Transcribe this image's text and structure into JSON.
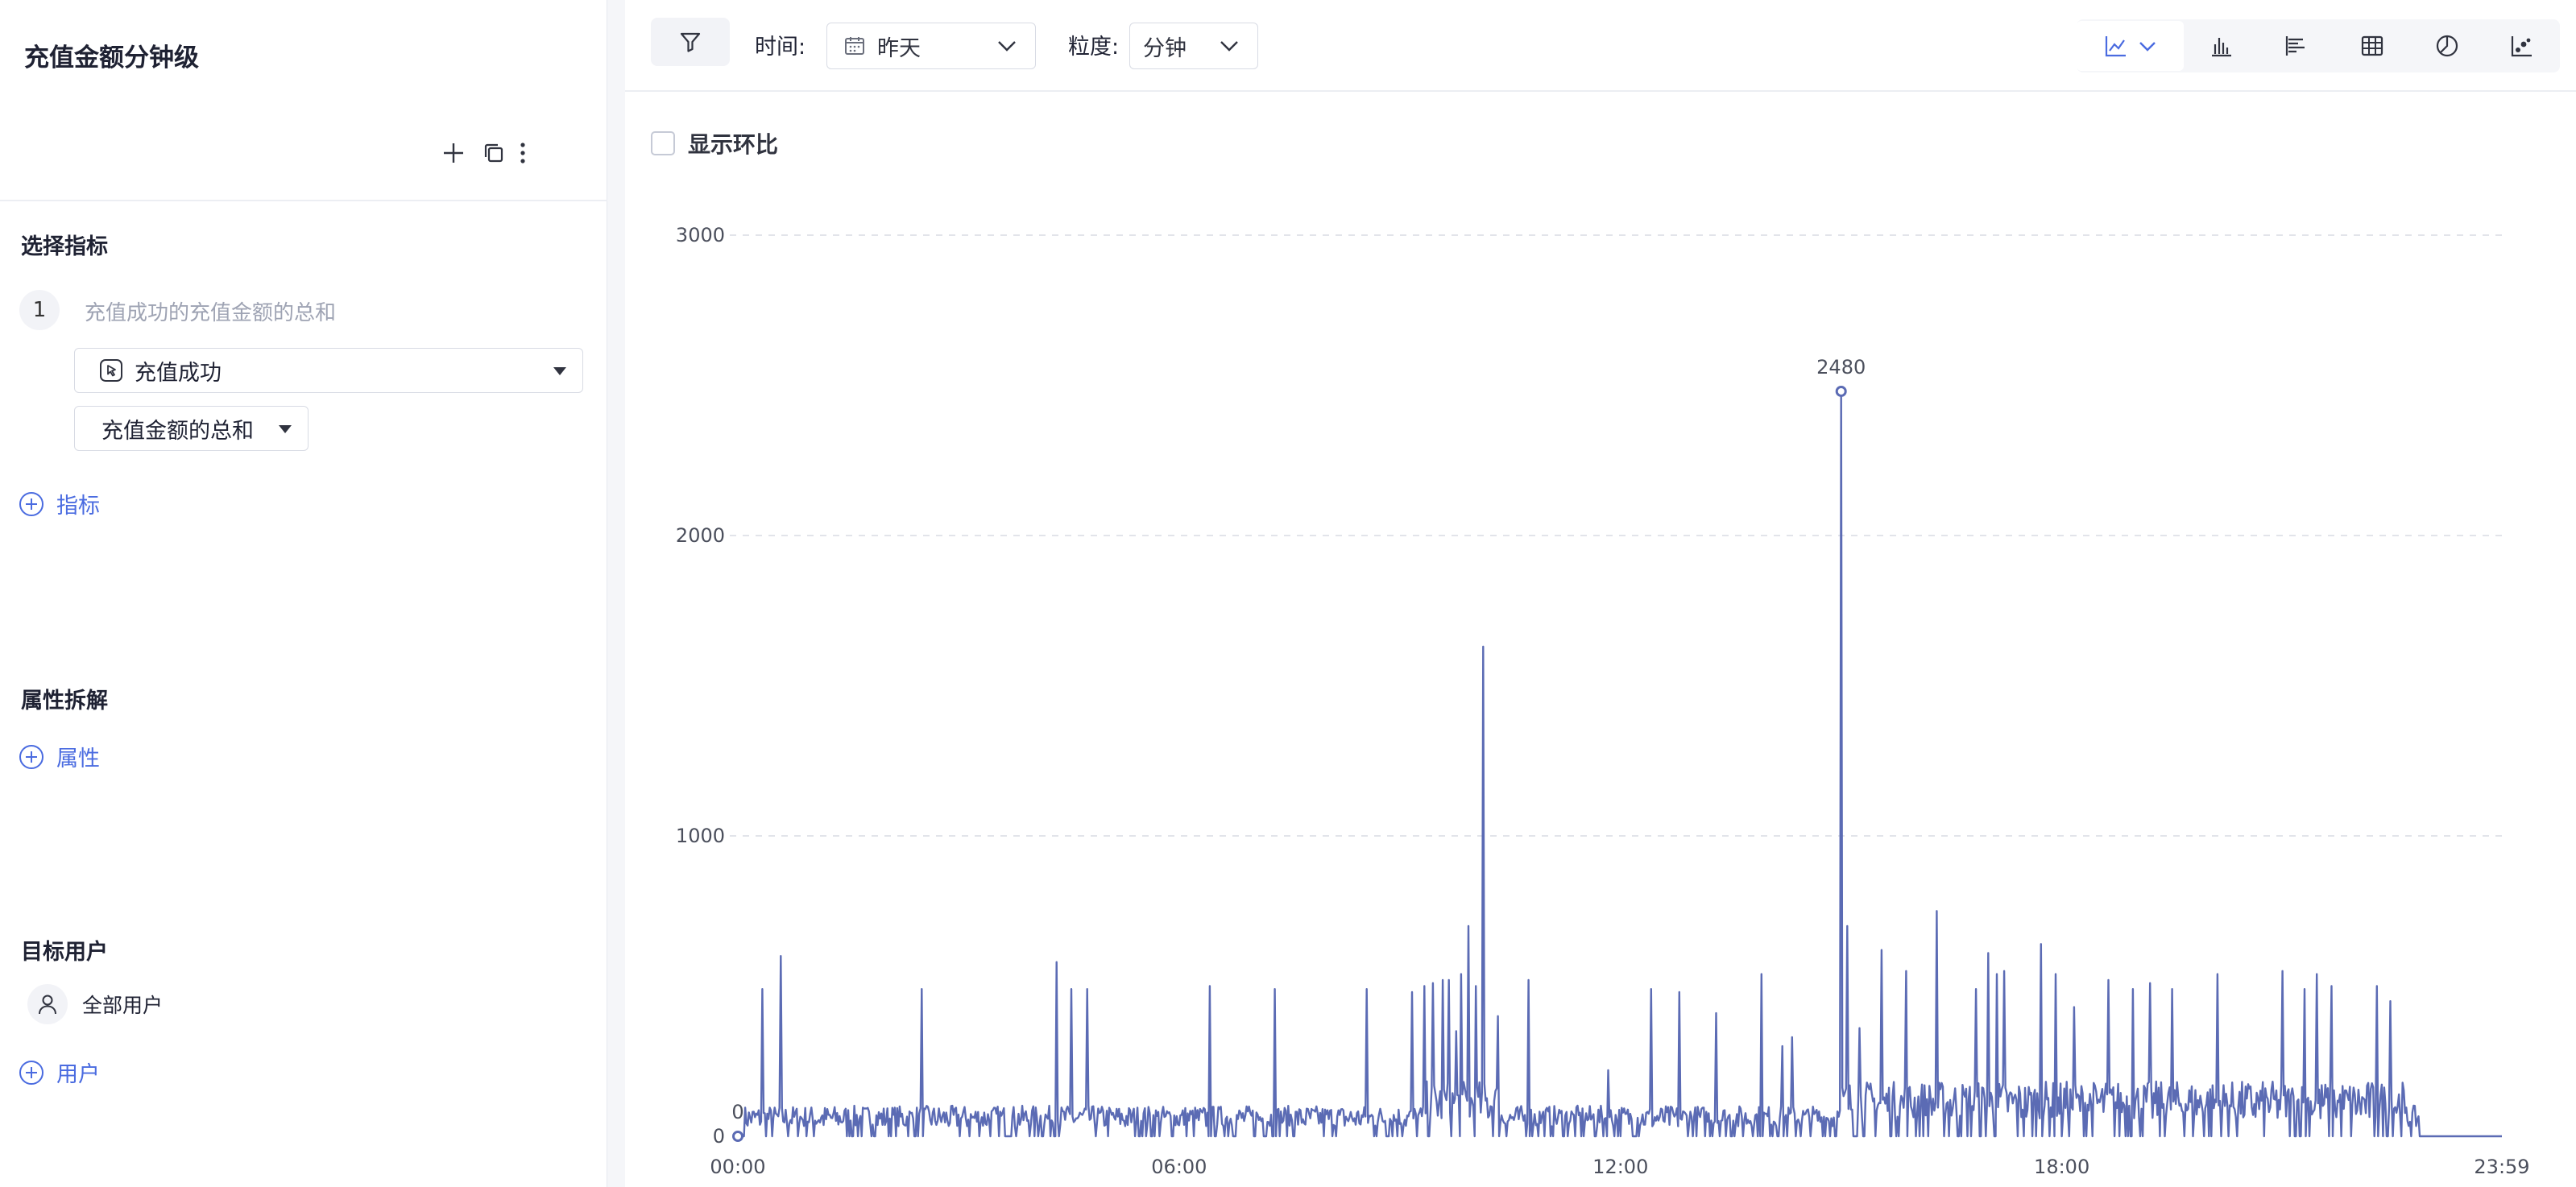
{
  "left": {
    "title": "充值金额分钟级",
    "sections": {
      "metrics": "选择指标",
      "breakdown": "属性拆解",
      "target_users": "目标用户"
    },
    "metric": {
      "index": "1",
      "name": "充值成功的充值金额的总和",
      "event": "充值成功",
      "aggregation": "充值金额的总和"
    },
    "add_metric": "指标",
    "add_property": "属性",
    "all_users": "全部用户",
    "add_user": "用户"
  },
  "toolbar": {
    "time_label": "时间:",
    "time_value": "昨天",
    "granularity_label": "粒度:",
    "granularity_value": "分钟",
    "viz_icons": [
      "line-chart-icon",
      "bar-chart-icon",
      "horizontal-bar-icon",
      "table-icon",
      "pie-chart-icon",
      "scatter-icon"
    ]
  },
  "compare": {
    "label": "显示环比",
    "checked": false
  },
  "colors": {
    "line": "#5b6bb4",
    "accent": "#4a6be0",
    "grid": "#e2e4ea"
  },
  "chart_data": {
    "type": "line",
    "title": "",
    "xlabel": "",
    "ylabel": "",
    "x_ticks": [
      "00:00",
      "06:00",
      "12:00",
      "18:00",
      "23:59"
    ],
    "y_ticks": [
      0,
      1000,
      2000,
      3000
    ],
    "ylim": [
      0,
      3000
    ],
    "xlim_minutes": [
      0,
      1439
    ],
    "grid": "horizontal-dashed",
    "annotations": [
      {
        "minute": 0,
        "value": 0,
        "label": "0"
      },
      {
        "minute": 900,
        "value": 2480,
        "label": "2480"
      }
    ],
    "baseline": 60,
    "peaks": [
      [
        20,
        490
      ],
      [
        35,
        600
      ],
      [
        150,
        490
      ],
      [
        260,
        580
      ],
      [
        272,
        490
      ],
      [
        285,
        490
      ],
      [
        385,
        500
      ],
      [
        438,
        490
      ],
      [
        513,
        490
      ],
      [
        550,
        480
      ],
      [
        560,
        500
      ],
      [
        567,
        510
      ],
      [
        575,
        520
      ],
      [
        580,
        520
      ],
      [
        586,
        350
      ],
      [
        590,
        540
      ],
      [
        596,
        700
      ],
      [
        602,
        500
      ],
      [
        608,
        1630
      ],
      [
        620,
        400
      ],
      [
        645,
        520
      ],
      [
        710,
        220
      ],
      [
        745,
        490
      ],
      [
        768,
        480
      ],
      [
        798,
        410
      ],
      [
        835,
        540
      ],
      [
        852,
        300
      ],
      [
        860,
        330
      ],
      [
        900,
        2480
      ],
      [
        905,
        700
      ],
      [
        915,
        360
      ],
      [
        933,
        620
      ],
      [
        953,
        550
      ],
      [
        978,
        750
      ],
      [
        1010,
        490
      ],
      [
        1020,
        610
      ],
      [
        1027,
        540
      ],
      [
        1033,
        550
      ],
      [
        1063,
        640
      ],
      [
        1075,
        540
      ],
      [
        1090,
        430
      ],
      [
        1118,
        520
      ],
      [
        1138,
        490
      ],
      [
        1152,
        510
      ],
      [
        1170,
        490
      ],
      [
        1207,
        540
      ],
      [
        1260,
        550
      ],
      [
        1278,
        490
      ],
      [
        1288,
        540
      ],
      [
        1300,
        500
      ],
      [
        1337,
        500
      ],
      [
        1348,
        450
      ]
    ],
    "tail_from_minute": 1372
  }
}
